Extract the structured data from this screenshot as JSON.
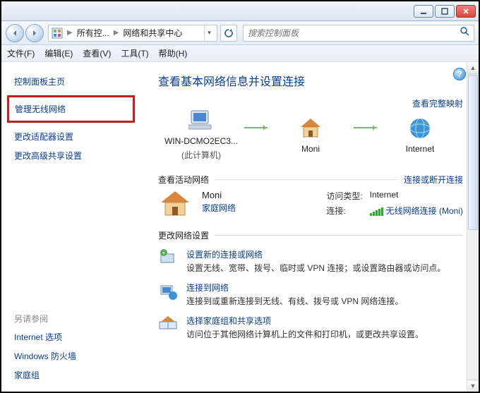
{
  "window": {
    "min_tip": "最小化",
    "max_tip": "最大化",
    "close_tip": "关闭"
  },
  "breadcrumb": {
    "level1": "所有控...",
    "level2": "网络和共享中心"
  },
  "search": {
    "placeholder": "搜索控制面板"
  },
  "menu": {
    "file": "文件(F)",
    "edit": "编辑(E)",
    "view": "查看(V)",
    "tools": "工具(T)",
    "help": "帮助(H)"
  },
  "sidebar": {
    "home": "控制面板主页",
    "wireless": "管理无线网络",
    "adapter": "更改适配器设置",
    "advanced": "更改高级共享设置",
    "seealso": "另请参阅",
    "internet_options": "Internet 选项",
    "firewall": "Windows 防火墙",
    "homegroup": "家庭组"
  },
  "main": {
    "heading": "查看基本网络信息并设置连接",
    "maplink": "查看完整映射",
    "node_pc": "WIN-DCMO2EC3...",
    "node_pc_sub": "(此计算机)",
    "node_router": "Moni",
    "node_internet": "Internet",
    "active_heading": "查看活动网络",
    "active_link": "连接或断开连接",
    "active_name": "Moni",
    "active_type": "家庭网络",
    "kv_access_k": "访问类型:",
    "kv_access_v": "Internet",
    "kv_conn_k": "连接:",
    "kv_conn_v": "无线网络连接 (Moni)",
    "settings_heading": "更改网络设置",
    "opt1_title": "设置新的连接或网络",
    "opt1_desc": "设置无线、宽带、拨号、临时或 VPN 连接；或设置路由器或访问点。",
    "opt2_title": "连接到网络",
    "opt2_desc": "连接到或重新连接到无线、有线、拨号或 VPN 网络连接。",
    "opt3_title": "选择家庭组和共享选项",
    "opt3_desc": "访问位于其他网络计算机上的文件和打印机，或更改共享设置。"
  }
}
